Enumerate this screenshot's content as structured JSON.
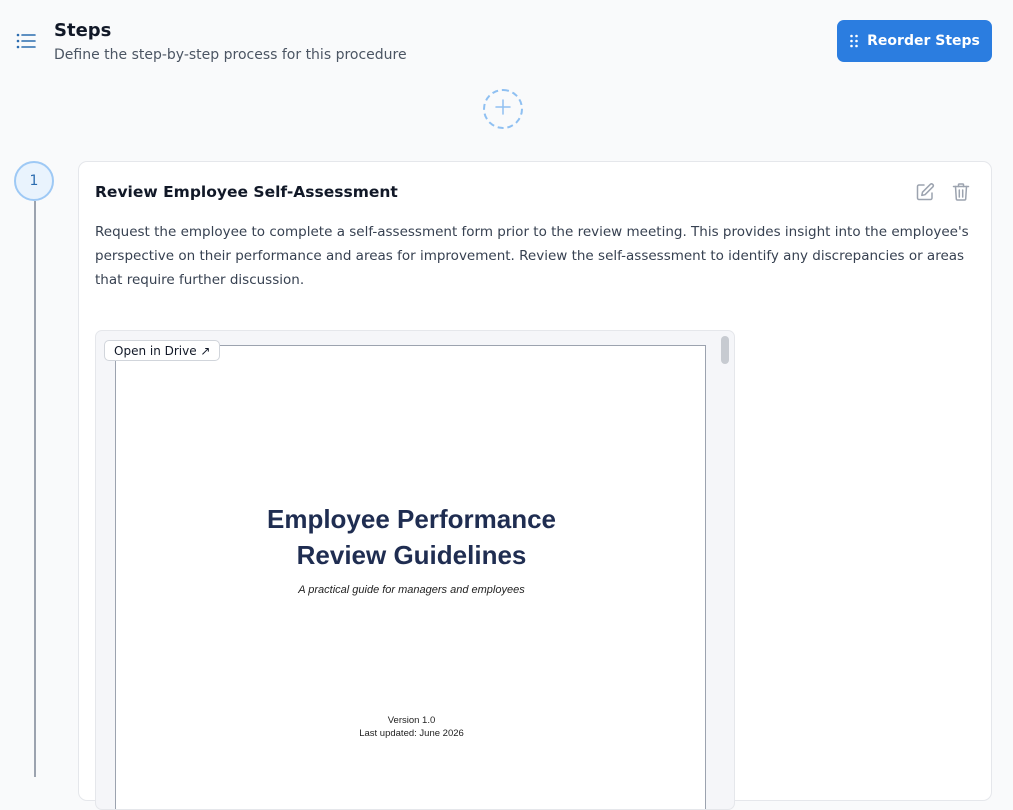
{
  "header": {
    "title": "Steps",
    "subtitle": "Define the step-by-step process for this procedure",
    "reorder_button_label": "Reorder Steps",
    "icons": {
      "list": "list-icon",
      "reorder": "drag-handle-icon"
    }
  },
  "add_step": {
    "icon": "plus-icon"
  },
  "steps": [
    {
      "number": "1",
      "title": "Review Employee Self-Assessment",
      "description": "Request the employee to complete a self-assessment form prior to the review meeting. This provides insight into the employee's perspective on their performance and areas for improvement. Review the self-assessment to identify any discrepancies or areas that require further discussion.",
      "actions": {
        "edit_icon": "edit-icon",
        "delete_icon": "trash-icon"
      },
      "attachment": {
        "open_label": "Open in Drive ↗",
        "document": {
          "title_line1": "Employee Performance",
          "title_line2": "Review Guidelines",
          "subtitle": "A practical guide for managers and employees",
          "version": "Version 1.0",
          "last_updated": "Last updated: June 2026"
        }
      }
    }
  ],
  "colors": {
    "accent": "#2b7de0",
    "doc_title": "#1f2d51",
    "step_circle_border": "#9ec9f5"
  }
}
